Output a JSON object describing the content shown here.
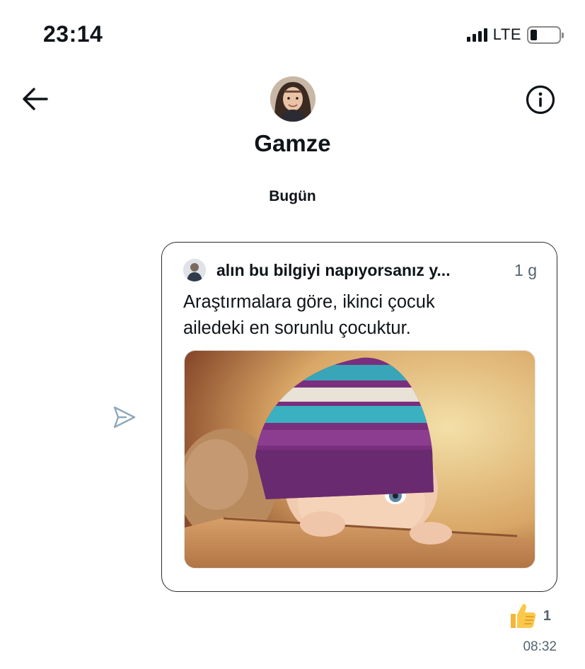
{
  "status_bar": {
    "time": "23:14",
    "network": "LTE",
    "battery_level": 0.2,
    "signal_bars": 4
  },
  "header": {
    "contact_name": "Gamze",
    "back_icon": "arrow-left-icon",
    "info_icon": "info-circle-icon"
  },
  "conversation": {
    "day_label": "Bugün",
    "message": {
      "quoted_post": {
        "author": "alın bu bilgiyi napıyorsanız y...",
        "age": "1 g",
        "text_line_1": "Araştırmalara göre, ikinci çocuk",
        "text_line_2": "ailedeki en sorunlu çocuktur."
      },
      "reaction_emoji": "👍",
      "reaction_count": "1",
      "time": "08:32"
    }
  },
  "colors": {
    "text_primary": "#0f1419",
    "text_secondary": "#536471",
    "send_icon": "#8ea8bb"
  }
}
